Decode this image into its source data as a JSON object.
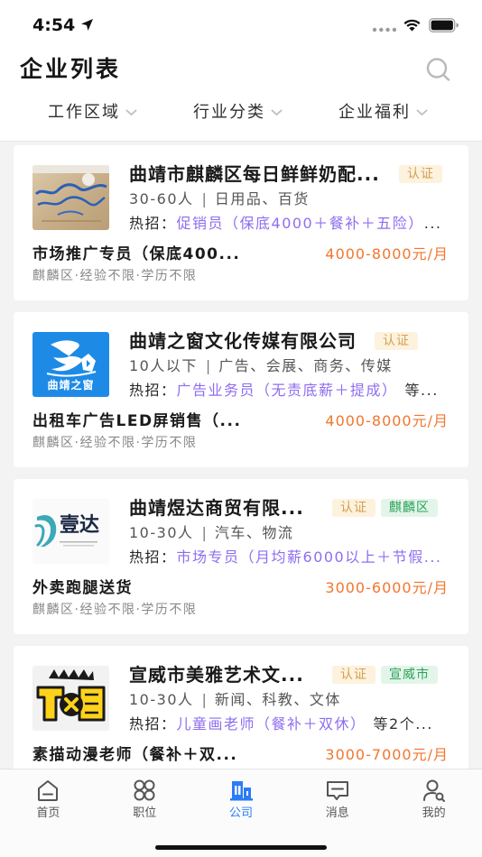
{
  "status_bar": {
    "time": "4:54",
    "icons": [
      "location-arrow-icon",
      "signal-icon",
      "wifi-icon",
      "battery-icon"
    ]
  },
  "header": {
    "title": "企业列表",
    "search_icon": "search-icon"
  },
  "filters": [
    {
      "label": "工作区域",
      "icon": "chevron-down-icon"
    },
    {
      "label": "行业分类",
      "icon": "chevron-down-icon"
    },
    {
      "label": "企业福利",
      "icon": "chevron-down-icon"
    }
  ],
  "companies": [
    {
      "name": "曲靖市麒麟区每日鲜鲜奶配...",
      "badges": [
        "认证"
      ],
      "size": "30-60人",
      "separator": "|",
      "industry": "日用品、百货",
      "hot_label": "热招：",
      "hot_job": "促销员（保底4000＋餐补＋五险）",
      "hot_suffix": "...",
      "job_title": "市场推广专员（保底400...",
      "salary": "4000-8000元/月",
      "meta": "麒麟区·经验不限·学历不限"
    },
    {
      "name": "曲靖之窗文化传媒有限公司",
      "logo_text": "曲靖之窗",
      "badges": [
        "认证"
      ],
      "size": "10人以下",
      "separator": "|",
      "industry": "广告、会展、商务、传媒",
      "hot_label": "热招：",
      "hot_job": "广告业务员（无责底薪＋提成）",
      "hot_suffix": "等...",
      "job_title": "出租车广告LED屏销售（...",
      "salary": "4000-8000元/月",
      "meta": "麒麟区·经验不限·学历不限"
    },
    {
      "name": "曲靖煜达商贸有限...",
      "logo_text": "壹达",
      "badges": [
        "认证",
        "麒麟区"
      ],
      "size": "10-30人",
      "separator": "|",
      "industry": "汽车、物流",
      "hot_label": "热招：",
      "hot_job": "市场专员（月均薪6000以上＋节假...",
      "job_title": "外卖跑腿送货",
      "salary": "3000-6000元/月",
      "meta": "麒麟区·经验不限·学历不限"
    },
    {
      "name": "宣威市美雅艺术文...",
      "badges": [
        "认证",
        "宣威市"
      ],
      "size": "10-30人",
      "separator": "|",
      "industry": "新闻、科教、文体",
      "hot_label": "热招：",
      "hot_job": "儿童画老师（餐补＋双休）",
      "hot_suffix": "等2个...",
      "job_title": "素描动漫老师（餐补＋双...",
      "salary": "3000-7000元/月"
    }
  ],
  "tabs": [
    {
      "label": "首页",
      "icon": "home-icon",
      "active": false
    },
    {
      "label": "职位",
      "icon": "grid-icon",
      "active": false
    },
    {
      "label": "公司",
      "icon": "building-icon",
      "active": true
    },
    {
      "label": "消息",
      "icon": "message-icon",
      "active": false
    },
    {
      "label": "我的",
      "icon": "user-icon",
      "active": false
    }
  ],
  "colors": {
    "accent": "#2b7cf6",
    "salary": "#f2762e",
    "hot_job": "#8f6df0",
    "cert_badge_bg": "#fdf2de",
    "cert_badge_text": "#d4a052",
    "region_badge_bg": "#e3f5e9",
    "region_badge_text": "#2aa25b",
    "list_background": "#f3f3f4"
  }
}
